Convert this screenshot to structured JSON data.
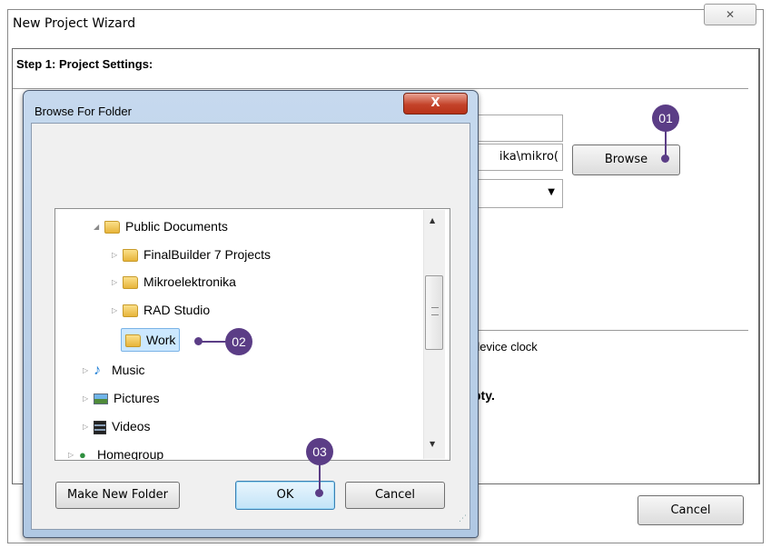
{
  "wizard": {
    "title": "New Project Wizard",
    "close_glyph": "✕",
    "step_title": "Step 1: Project Settings:",
    "path_field_value": "ika\\mikro(",
    "browse_label": "Browse",
    "device_clock_text": "device clock",
    "empty_text": "pty.",
    "cancel_label": "Cancel"
  },
  "browse_dialog": {
    "title": "Browse For Folder",
    "close_glyph": "X",
    "tree": [
      {
        "label": "Public Documents",
        "expander": "◢",
        "icon": "folder-icon"
      },
      {
        "label": "FinalBuilder 7 Projects",
        "expander": "▷",
        "icon": "folder-icon"
      },
      {
        "label": "Mikroelektronika",
        "expander": "▷",
        "icon": "folder-icon"
      },
      {
        "label": "RAD Studio",
        "expander": "▷",
        "icon": "folder-icon"
      },
      {
        "label": "Work",
        "expander": "",
        "icon": "folder-icon"
      },
      {
        "label": "Music",
        "expander": "▷",
        "icon": "music-icon"
      },
      {
        "label": "Pictures",
        "expander": "▷",
        "icon": "pictures-icon"
      },
      {
        "label": "Videos",
        "expander": "▷",
        "icon": "videos-icon"
      },
      {
        "label": "Homegroup",
        "expander": "▷",
        "icon": "homegroup-icon"
      }
    ],
    "make_new_folder_label": "Make New Folder",
    "ok_label": "OK",
    "cancel_label": "Cancel"
  },
  "callouts": {
    "c1": "01",
    "c2": "02",
    "c3": "03"
  },
  "colors": {
    "callout": "#5b3d86",
    "dialog_frame": "#b0c8e3",
    "close_red": "#c4432a",
    "selection": "#cce8ff"
  }
}
